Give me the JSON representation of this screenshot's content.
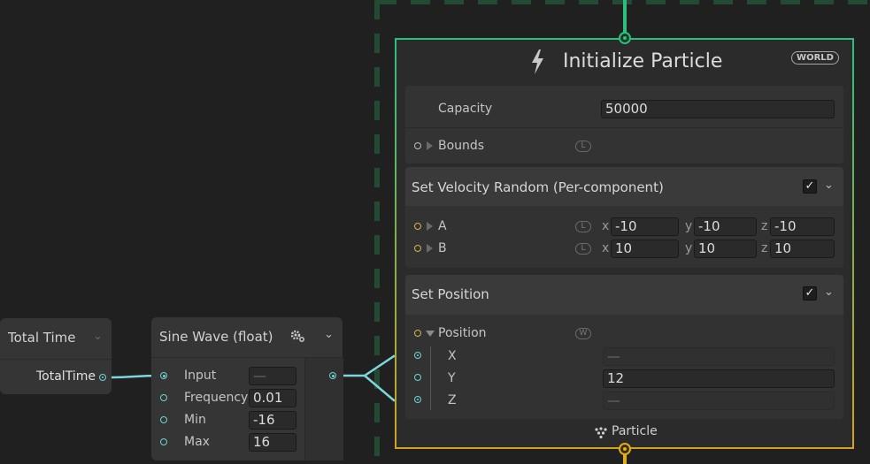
{
  "total_time_node": {
    "title": "Total Time",
    "output_label": "TotalTime"
  },
  "sine_node": {
    "title": "Sine Wave (float)",
    "inputs": [
      {
        "label": "Input",
        "value": "—"
      },
      {
        "label": "Frequency",
        "value": "0.01"
      },
      {
        "label": "Min",
        "value": "-16"
      },
      {
        "label": "Max",
        "value": "16"
      }
    ]
  },
  "context": {
    "title": "Initialize Particle",
    "space_badge": "WORLD",
    "capacity_label": "Capacity",
    "capacity_value": "50000",
    "bounds_label": "Bounds",
    "bounds_space": "L",
    "footer_label": "Particle"
  },
  "velocity_block": {
    "title": "Set Velocity Random (Per-component)",
    "enabled": "✓",
    "rows": [
      {
        "label": "A",
        "space": "L",
        "x": "-10",
        "y": "-10",
        "z": "-10"
      },
      {
        "label": "B",
        "space": "L",
        "x": "10",
        "y": "10",
        "z": "10"
      }
    ]
  },
  "position_block": {
    "title": "Set Position",
    "enabled": "✓",
    "label": "Position",
    "space": "W",
    "components": [
      {
        "label": "X",
        "value": "—"
      },
      {
        "label": "Y",
        "value": "12"
      },
      {
        "label": "Z",
        "value": "—"
      }
    ]
  },
  "axis_labels": {
    "x": "x",
    "y": "y",
    "z": "z"
  },
  "colors": {
    "background": "#202020",
    "node": "#353535",
    "context_border_top": "#2bbf7e",
    "context_border_bottom": "#d4a21e",
    "link": "#7fd6da",
    "port_yellow": "#d8b44a"
  }
}
